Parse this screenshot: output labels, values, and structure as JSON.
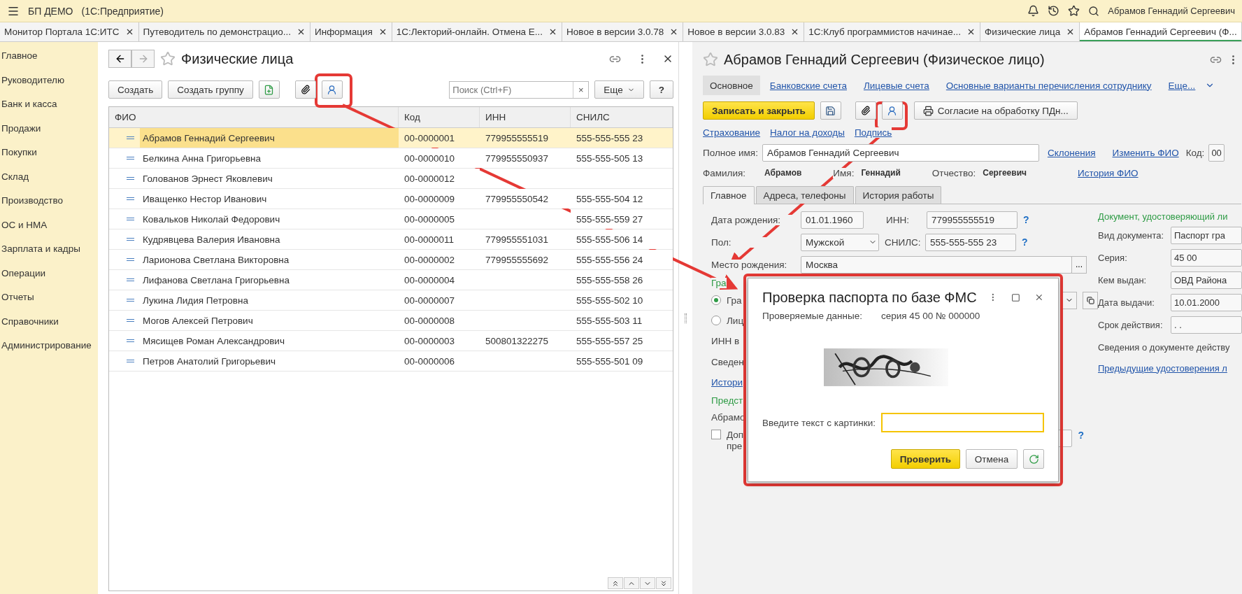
{
  "app": {
    "title": "БП ДЕМО",
    "subtitle": "(1С:Предприятие)",
    "user": "Абрамов Геннадий Сергеевич"
  },
  "tabs": [
    {
      "label": "Монитор Портала 1С:ИТС",
      "selected": false
    },
    {
      "label": "Путеводитель по демонстрацио...",
      "selected": false
    },
    {
      "label": "Информация",
      "selected": false
    },
    {
      "label": "1С:Лекторий-онлайн. Отмена Е...",
      "selected": false
    },
    {
      "label": "Новое в версии 3.0.78",
      "selected": false
    },
    {
      "label": "Новое в версии 3.0.83",
      "selected": false
    },
    {
      "label": "1С:Клуб программистов начинае...",
      "selected": false
    },
    {
      "label": "Физические лица",
      "selected": false
    },
    {
      "label": "Абрамов Геннадий Сергеевич (Ф...",
      "selected": true
    }
  ],
  "sidebar": [
    "Главное",
    "Руководителю",
    "Банк и касса",
    "Продажи",
    "Покупки",
    "Склад",
    "Производство",
    "ОС и НМА",
    "Зарплата и кадры",
    "Операции",
    "Отчеты",
    "Справочники",
    "Администрирование"
  ],
  "list": {
    "title": "Физические лица",
    "create": "Создать",
    "create_group": "Создать группу",
    "search": {
      "placeholder": "Поиск (Ctrl+F)",
      "clear": "×"
    },
    "more": "Еще",
    "help": "?",
    "columns": [
      "ФИО",
      "Код",
      "ИНН",
      "СНИЛС"
    ],
    "rows": [
      {
        "name": "Абрамов Геннадий Сергеевич",
        "code": "00-0000001",
        "inn": "779955555519",
        "snils": "555-555-555 23",
        "selected": true
      },
      {
        "name": "Белкина Анна Григорьевна",
        "code": "00-0000010",
        "inn": "779955550937",
        "snils": "555-555-505 13",
        "selected": false
      },
      {
        "name": "Голованов Эрнест Яковлевич",
        "code": "00-0000012",
        "inn": "",
        "snils": "",
        "selected": false
      },
      {
        "name": "Иващенко Нестор Иванович",
        "code": "00-0000009",
        "inn": "779955550542",
        "snils": "555-555-504 12",
        "selected": false
      },
      {
        "name": "Ковальков Николай Федорович",
        "code": "00-0000005",
        "inn": "",
        "snils": "555-555-559 27",
        "selected": false
      },
      {
        "name": "Кудрявцева Валерия Ивановна",
        "code": "00-0000011",
        "inn": "779955551031",
        "snils": "555-555-506 14",
        "selected": false
      },
      {
        "name": "Ларионова Светлана Викторовна",
        "code": "00-0000002",
        "inn": "779955555692",
        "snils": "555-555-556 24",
        "selected": false
      },
      {
        "name": "Лифанова Светлана Григорьевна",
        "code": "00-0000004",
        "inn": "",
        "snils": "555-555-558 26",
        "selected": false
      },
      {
        "name": "Лукина Лидия Петровна",
        "code": "00-0000007",
        "inn": "",
        "snils": "555-555-502 10",
        "selected": false
      },
      {
        "name": "Могов Алексей Петрович",
        "code": "00-0000008",
        "inn": "",
        "snils": "555-555-503 11",
        "selected": false
      },
      {
        "name": "Мясищев Роман Александрович",
        "code": "00-0000003",
        "inn": "500801322275",
        "snils": "555-555-557 25",
        "selected": false
      },
      {
        "name": "Петров Анатолий Григорьевич",
        "code": "00-0000006",
        "inn": "",
        "snils": "555-555-501 09",
        "selected": false
      }
    ]
  },
  "person": {
    "title": "Абрамов Геннадий Сергеевич (Физическое лицо)",
    "sections": [
      {
        "label": "Основное",
        "selected": true
      },
      {
        "label": "Банковские счета",
        "selected": false
      },
      {
        "label": "Лицевые счета",
        "selected": false
      },
      {
        "label": "Основные варианты перечисления сотруднику",
        "selected": false
      },
      {
        "label": "Еще...",
        "selected": false
      }
    ],
    "save_close": "Записать и закрыть",
    "consent": "Согласие на обработку ПДн...",
    "links": [
      "Страхование",
      "Налог на доходы",
      "Подпись"
    ],
    "full_name_label": "Полное имя:",
    "full_name": "Абрамов Геннадий Сергеевич",
    "declension": "Склонения",
    "change_name": "Изменить ФИО",
    "code_label": "Код:",
    "code": "00",
    "parts": [
      {
        "label": "Фамилия:",
        "value": "Абрамов"
      },
      {
        "label": "Имя:",
        "value": "Геннадий"
      },
      {
        "label": "Отчество:",
        "value": "Сергеевич"
      }
    ],
    "name_history": "История ФИО",
    "inner_tabs": [
      {
        "label": "Главное",
        "selected": true
      },
      {
        "label": "Адреса, телефоны",
        "selected": false
      },
      {
        "label": "История работы",
        "selected": false
      }
    ],
    "birth_label": "Дата рождения:",
    "birth": "01.01.1960",
    "inn_label": "ИНН:",
    "inn": "779955555519",
    "help": "?",
    "sex_label": "Пол:",
    "sex": "Мужской",
    "snils_label": "СНИЛС:",
    "snils": "555-555-555 23",
    "place_label": "Место рождения:",
    "place": "Москва",
    "place_btn": "...",
    "citizenship": "Гра",
    "radios": [
      {
        "label": "Гра",
        "checked": true
      },
      {
        "label": "Лиц",
        "checked": false
      }
    ],
    "inn_in": "ИНН в",
    "info": "Сведен",
    "history_link": "Истори",
    "rep_heading": "Предст",
    "rep": "Абрамо",
    "extra": {
      "line1": "Доп",
      "line2": "пре",
      "checked": false
    },
    "doc": {
      "heading": "Документ, удостоверяющий ли",
      "rows": [
        {
          "label": "Вид документа:",
          "value": "Паспорт гра"
        },
        {
          "label": "Серия:",
          "value": "45 00"
        },
        {
          "label": "Кем выдан:",
          "value": "ОВД Района"
        },
        {
          "label": "Дата выдачи:",
          "value": "10.01.2000"
        },
        {
          "label": "Срок действия:",
          "value": ". ."
        }
      ],
      "info": "Сведения о документе действу",
      "previous": "Предыдущие удостоверения л"
    }
  },
  "dialog": {
    "title": "Проверка паспорта по базе ФМС",
    "data_label": "Проверяемые данные:",
    "data": "серия 45 00 № 000000",
    "prompt": "Введите текст с картинки:",
    "check": "Проверить",
    "cancel": "Отмена"
  }
}
